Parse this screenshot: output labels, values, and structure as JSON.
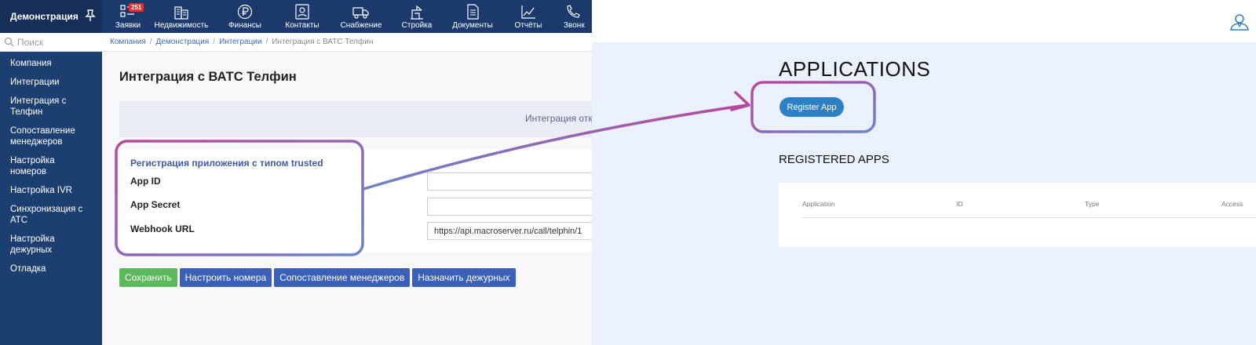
{
  "left": {
    "brand": "Демонстрация",
    "nav": [
      {
        "label": "Заявки",
        "icon": "tasks-icon",
        "badge": "251"
      },
      {
        "label": "Недвижимость",
        "icon": "buildings-icon"
      },
      {
        "label": "Финансы",
        "icon": "ruble-icon"
      },
      {
        "label": "Контакты",
        "icon": "contacts-icon"
      },
      {
        "label": "Снабжение",
        "icon": "truck-icon"
      },
      {
        "label": "Стройка",
        "icon": "crane-icon"
      },
      {
        "label": "Документы",
        "icon": "document-icon"
      },
      {
        "label": "Отчёты",
        "icon": "chart-icon"
      },
      {
        "label": "Звонк",
        "icon": "phone-icon"
      }
    ],
    "search_placeholder": "Поиск",
    "sidebar": [
      "Компания",
      "Интеграции",
      "Интеграция с Телфин",
      "Сопоставление менеджеров",
      "Настройка номеров",
      "Настройка IVR",
      "Синхронизация с АТС",
      "Настройка дежурных",
      "Отладка"
    ],
    "breadcrumb": {
      "items": [
        "Компания",
        "Демонстрация",
        "Интеграции"
      ],
      "current": "Интеграция с ВАТС Телфин"
    },
    "page_title": "Интеграция с ВАТС Телфин",
    "notice": "Интеграция откл",
    "form": {
      "section": "Регистрация приложения с типом trusted",
      "app_id_label": "App ID",
      "app_id_value": "",
      "app_secret_label": "App Secret",
      "app_secret_value": "",
      "webhook_label": "Webhook URL",
      "webhook_value": "https://api.macroserver.ru/call/telphin/1"
    },
    "buttons": {
      "save": "Сохранить",
      "numbers": "Настроить номера",
      "managers": "Сопоставление менеджеров",
      "duty": "Назначить дежурных"
    }
  },
  "right": {
    "title": "APPLICATIONS",
    "register_button": "Register App",
    "registered_title": "REGISTERED APPS",
    "table_headers": [
      "Application",
      "ID",
      "Type",
      "Access"
    ]
  },
  "colors": {
    "topbar": "#1b3a6b",
    "sidebar": "#1c3f72",
    "annotation_magenta": "#b8489e",
    "annotation_blue": "#6b85c6",
    "register_button": "#2e80c4"
  }
}
